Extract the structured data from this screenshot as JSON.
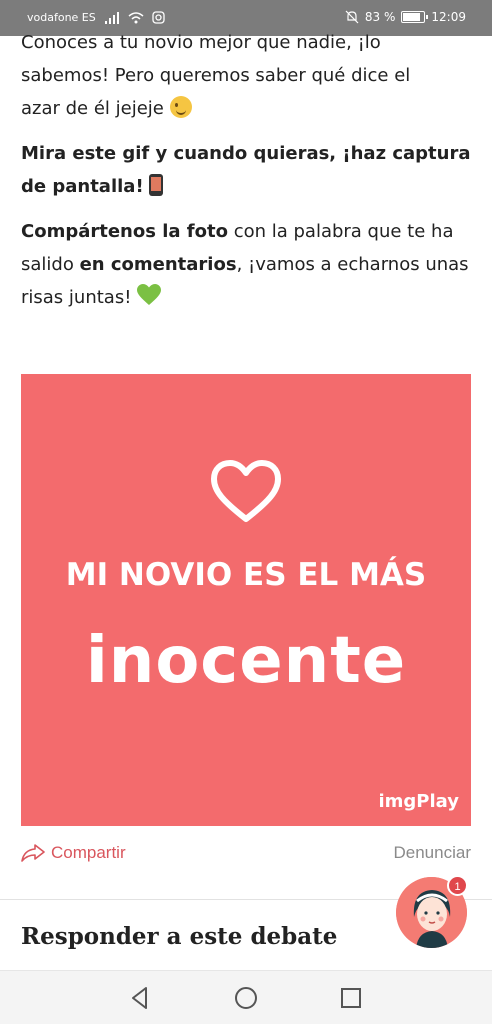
{
  "status_bar": {
    "carrier": "vodafone ES",
    "battery_text": "83 %",
    "battery_level": 0.83,
    "time": "12:09"
  },
  "article": {
    "p1_line0": "Conoces a tu novio mejor que nadie, ¡lo",
    "p1_line1": "sabemos! Pero queremos saber qué dice el",
    "p1_line2": "azar de él jejeje",
    "p2_bold": "Mira este gif y cuando quieras, ¡haz captura de pantalla!",
    "p3_bold1": "Compártenos la foto",
    "p3_text1": " con la palabra que te ha salido ",
    "p3_bold2": "en comentarios",
    "p3_text2": ", ¡vamos a echarnos unas risas juntas!"
  },
  "gif": {
    "line1": "MI NOVIO ES EL MÁS",
    "line2": "inocente",
    "brand": "imgPlay",
    "background_color": "#f36b6d"
  },
  "actions": {
    "share_label": "Compartir",
    "report_label": "Denunciar"
  },
  "reply": {
    "title": "Responder a este debate"
  },
  "chat": {
    "badge_count": "1"
  },
  "icons": [
    "wink-emoji-icon",
    "phone-emoji-icon",
    "green-heart-emoji-icon",
    "share-icon",
    "back-nav-icon",
    "home-nav-icon",
    "recents-nav-icon"
  ]
}
